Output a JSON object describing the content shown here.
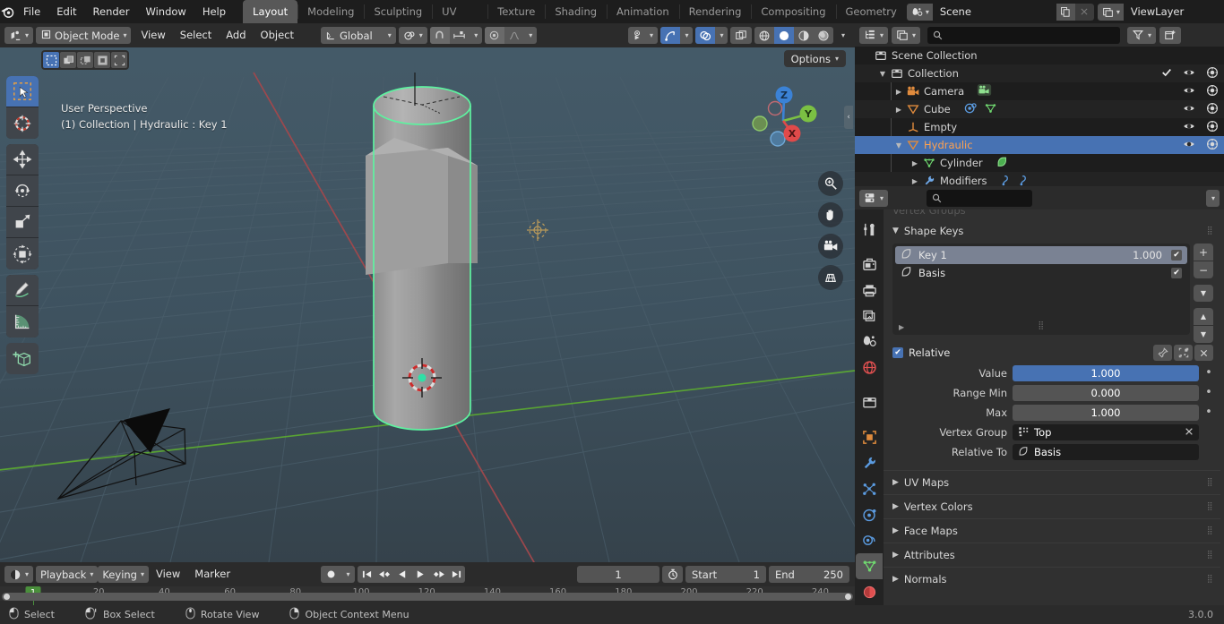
{
  "topbar": {
    "logo_icon": "blender-logo-icon",
    "menus": [
      "File",
      "Edit",
      "Render",
      "Window",
      "Help"
    ],
    "workspaces": [
      {
        "label": "Layout",
        "active": true
      },
      {
        "label": "Modeling",
        "active": false
      },
      {
        "label": "Sculpting",
        "active": false
      },
      {
        "label": "UV Editing",
        "active": false
      },
      {
        "label": "Texture Paint",
        "active": false
      },
      {
        "label": "Shading",
        "active": false
      },
      {
        "label": "Animation",
        "active": false
      },
      {
        "label": "Rendering",
        "active": false
      },
      {
        "label": "Compositing",
        "active": false
      },
      {
        "label": "Geometry Nod",
        "active": false
      }
    ],
    "scene_name": "Scene",
    "viewlayer_name": "ViewLayer",
    "scene_icon": "scene-icon",
    "viewlayer_icon": "viewlayer-icon",
    "copy_icon": "duplicate-icon",
    "close_icon": "close-icon"
  },
  "viewport": {
    "mode": "Object Mode",
    "mode_icon": "object-mode-icon",
    "menus": [
      "View",
      "Select",
      "Add",
      "Object"
    ],
    "transform_orientation": "Global",
    "orientation_icon": "orientation-axis-icon",
    "pivot_icon": "pivot-point-icon",
    "snap_icon": "snap-magnet-icon",
    "snap_to_icon": "snap-increment-icon",
    "proportional_icon": "proportional-edit-icon",
    "falloff_icon": "falloff-curve-icon",
    "visibility_icon": "object-visibility-icon",
    "gizmo_icon": "gizmo-icon",
    "overlays_icon": "overlays-icon",
    "xray_icon": "xray-toggle-icon",
    "shading_modes": [
      {
        "name": "wireframe-shading-icon",
        "active": false
      },
      {
        "name": "solid-shading-icon",
        "active": true
      },
      {
        "name": "material-preview-shading-icon",
        "active": false
      },
      {
        "name": "rendered-shading-icon",
        "active": false
      }
    ],
    "select_modes": [
      {
        "name": "tweak-select-icon",
        "active": true
      },
      {
        "name": "box-select-icon",
        "active": false
      },
      {
        "name": "circle-select-icon",
        "active": false
      },
      {
        "name": "lasso-select-icon",
        "active": false
      },
      {
        "name": "extend-select-icon",
        "active": false
      }
    ],
    "options_label": "Options",
    "overlay_line1": "User Perspective",
    "overlay_line2": "(1) Collection | Hydraulic : Key 1",
    "tools": [
      {
        "name": "tweak-tool-icon",
        "active": true
      },
      {
        "name": "cursor-tool-icon",
        "active": false
      },
      {
        "name": "move-tool-icon",
        "active": false
      },
      {
        "name": "rotate-tool-icon",
        "active": false
      },
      {
        "name": "scale-tool-icon",
        "active": false
      },
      {
        "name": "transform-tool-icon",
        "active": false
      },
      {
        "name": "annotate-tool-icon",
        "active": false
      },
      {
        "name": "measure-tool-icon",
        "active": false
      },
      {
        "name": "add-cube-tool-icon",
        "active": false
      }
    ],
    "gizmo_axes": [
      {
        "label": "Z",
        "color": "#3b82d6"
      },
      {
        "label": "Y",
        "color": "#7bc043"
      },
      {
        "label": "X",
        "color": "#e04a4a"
      }
    ],
    "nav_buttons": [
      "zoom-icon",
      "pan-hand-icon",
      "camera-view-icon",
      "toggle-perspective-icon"
    ],
    "background_color": "#3f5461",
    "selection_outline_color": "#5ef2a0"
  },
  "timeline": {
    "editor_icon": "timeline-editor-icon",
    "menus": [
      "Playback",
      "Keying",
      "View",
      "Marker"
    ],
    "autokey_icon": "record-keying-icon",
    "transport": [
      "jump-to-start-icon",
      "jump-to-prev-keyframe-icon",
      "play-reverse-icon",
      "play-icon",
      "jump-to-next-keyframe-icon",
      "jump-to-end-icon"
    ],
    "current_frame": "1",
    "frame_icon": "use-preview-range-icon",
    "start_label": "Start",
    "start_value": "1",
    "end_label": "End",
    "end_value": "250",
    "ticks": [
      "20",
      "40",
      "60",
      "80",
      "100",
      "120",
      "140",
      "160",
      "180",
      "200",
      "220",
      "240"
    ],
    "playhead_frame": "1"
  },
  "statusbar": {
    "items": [
      {
        "icon": "mouse-left-icon",
        "label": "Select"
      },
      {
        "icon": "mouse-left-drag-icon",
        "label": "Box Select"
      },
      {
        "icon": "mouse-middle-icon",
        "label": "Rotate View"
      },
      {
        "icon": "mouse-right-icon",
        "label": "Object Context Menu"
      }
    ],
    "version": "3.0.0"
  },
  "outliner": {
    "display_mode_icon": "outliner-display-mode-icon",
    "filter_id_icon": "outliner-id-type-icon",
    "search_icon": "search-icon",
    "filter_icon": "filter-funnel-icon",
    "new_collection_icon": "new-collection-icon",
    "rows": [
      {
        "label": "Scene Collection",
        "icon": "scene-collection-icon",
        "indent": 0,
        "disclosure": "",
        "selected": false,
        "checkbox": false,
        "eye": false,
        "camera": false,
        "orange": false,
        "badges": []
      },
      {
        "label": "Collection",
        "icon": "collection-icon",
        "indent": 1,
        "disclosure": "open",
        "selected": false,
        "checkbox": true,
        "eye": true,
        "camera": true,
        "orange": false,
        "badges": []
      },
      {
        "label": "Camera",
        "icon": "camera-object-icon",
        "indent": 2,
        "disclosure": "closed",
        "selected": false,
        "checkbox": false,
        "eye": true,
        "camera": true,
        "orange": false,
        "badges": [
          "camera-data-icon"
        ]
      },
      {
        "label": "Cube",
        "icon": "mesh-object-icon",
        "indent": 2,
        "disclosure": "closed",
        "selected": false,
        "checkbox": false,
        "eye": true,
        "camera": true,
        "orange": false,
        "badges": [
          "modifier-icon",
          "mesh-data-icon"
        ]
      },
      {
        "label": "Empty",
        "icon": "empty-axes-icon",
        "indent": 2,
        "disclosure": "",
        "selected": false,
        "checkbox": false,
        "eye": true,
        "camera": true,
        "orange": false,
        "badges": []
      },
      {
        "label": "Hydraulic",
        "icon": "mesh-object-icon",
        "indent": 2,
        "disclosure": "open",
        "selected": true,
        "checkbox": false,
        "eye": true,
        "camera": true,
        "orange": true,
        "badges": []
      },
      {
        "label": "Cylinder",
        "icon": "mesh-data-icon",
        "indent": 3,
        "disclosure": "closed",
        "selected": false,
        "checkbox": false,
        "eye": false,
        "camera": false,
        "orange": false,
        "badges": [
          "material-icon"
        ]
      },
      {
        "label": "Modifiers",
        "icon": "modifier-wrench-icon",
        "indent": 3,
        "disclosure": "closed",
        "selected": false,
        "checkbox": false,
        "eye": false,
        "camera": false,
        "orange": false,
        "badges": [
          "hook-modifier-icon",
          "hook-modifier-icon"
        ]
      }
    ]
  },
  "properties": {
    "editor_icon": "properties-editor-icon",
    "search_icon": "search-icon",
    "options_caret_icon": "chevron-down-icon",
    "tabs": [
      {
        "name": "tool-tab-icon",
        "active": false
      },
      {
        "name": "render-tab-icon",
        "active": false
      },
      {
        "name": "output-tab-icon",
        "active": false
      },
      {
        "name": "view-layer-tab-icon",
        "active": false
      },
      {
        "name": "scene-tab-icon",
        "active": false
      },
      {
        "name": "world-tab-icon",
        "active": false
      },
      {
        "name": "collection-tab-icon",
        "active": false
      },
      {
        "name": "object-tab-icon",
        "active": false
      },
      {
        "name": "modifier-tab-icon",
        "active": false
      },
      {
        "name": "particles-tab-icon",
        "active": false
      },
      {
        "name": "physics-tab-icon",
        "active": false
      },
      {
        "name": "constraints-tab-icon",
        "active": false
      },
      {
        "name": "object-data-tab-icon",
        "active": true
      },
      {
        "name": "material-tab-icon",
        "active": false
      }
    ],
    "cut_panel_label": "Vertex Groups",
    "shape_keys": {
      "panel_label": "Shape Keys",
      "items": [
        {
          "name": "Basis",
          "value": "",
          "selected": false,
          "enabled": true,
          "icon": "shapekey-icon"
        },
        {
          "name": "Key 1",
          "value": "1.000",
          "selected": true,
          "enabled": true,
          "icon": "shapekey-icon"
        }
      ],
      "side_buttons": [
        "add-shapekey-icon",
        "remove-shapekey-icon",
        "shapekey-specials-icon",
        "move-up-icon",
        "move-down-icon"
      ]
    },
    "relative": {
      "label": "Relative",
      "checked": true,
      "header_buttons": [
        "pin-icon",
        "edit-mode-display-icon",
        "close-icon"
      ],
      "fields": [
        {
          "label": "Value",
          "value": "1.000",
          "style": "blue",
          "anim_dot": true
        },
        {
          "label": "Range Min",
          "value": "0.000",
          "style": "grey",
          "anim_dot": true
        },
        {
          "label": "Max",
          "value": "1.000",
          "style": "grey",
          "anim_dot": true
        }
      ],
      "vertex_group_label": "Vertex Group",
      "vertex_group_value": "Top",
      "vertex_group_icon": "vertex-group-icon",
      "relative_to_label": "Relative To",
      "relative_to_value": "Basis",
      "relative_to_icon": "shapekey-icon"
    },
    "closed_panels": [
      "UV Maps",
      "Vertex Colors",
      "Face Maps",
      "Attributes",
      "Normals"
    ]
  }
}
